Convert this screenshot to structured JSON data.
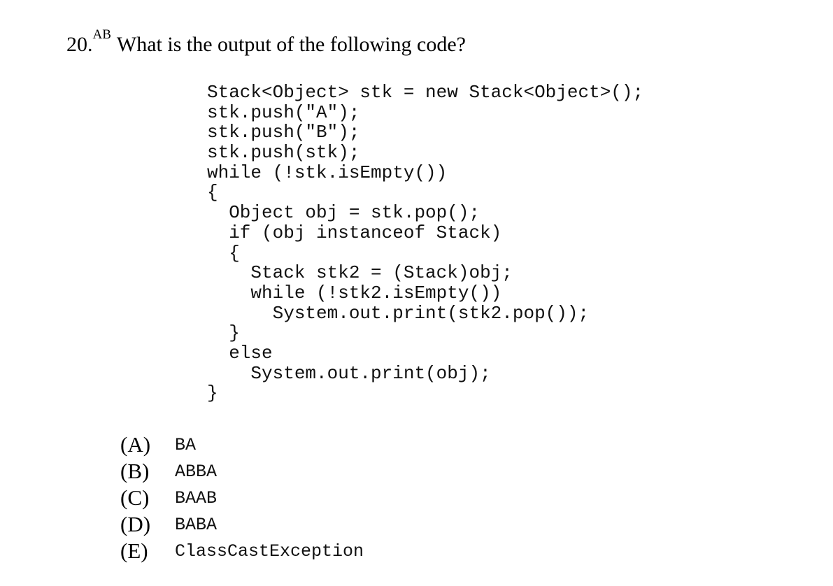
{
  "question": {
    "number": "20.",
    "superscript": "AB",
    "text": "What is the output of the following code?"
  },
  "code_lines": [
    "Stack<Object> stk = new Stack<Object>();",
    "stk.push(\"A\");",
    "stk.push(\"B\");",
    "stk.push(stk);",
    "while (!stk.isEmpty())",
    "{",
    "  Object obj = stk.pop();",
    "  if (obj instanceof Stack)",
    "  {",
    "    Stack stk2 = (Stack)obj;",
    "    while (!stk2.isEmpty())",
    "      System.out.print(stk2.pop());",
    "  }",
    "  else",
    "    System.out.print(obj);",
    "}"
  ],
  "options": [
    {
      "letter": "(A)",
      "text": "BA"
    },
    {
      "letter": "(B)",
      "text": "ABBA"
    },
    {
      "letter": "(C)",
      "text": "BAAB"
    },
    {
      "letter": "(D)",
      "text": "BABA"
    },
    {
      "letter": "(E)",
      "text": "ClassCastException"
    }
  ]
}
